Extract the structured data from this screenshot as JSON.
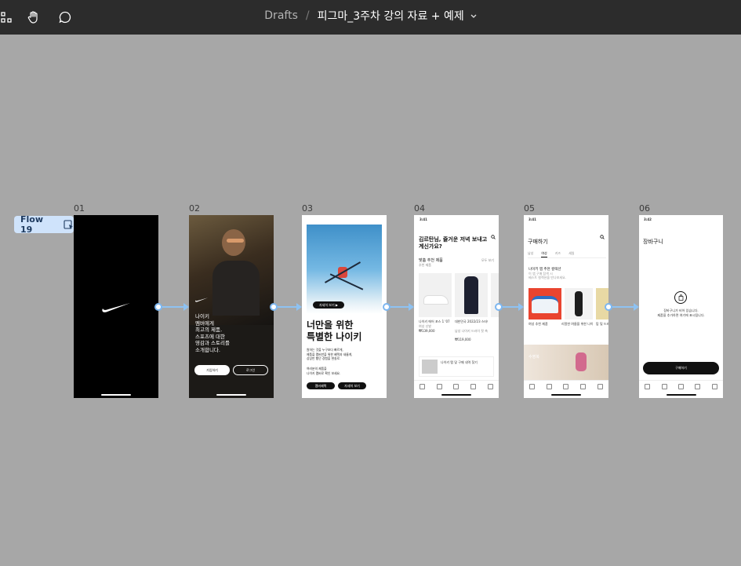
{
  "toolbar": {
    "breadcrumb_drafts": "Drafts",
    "breadcrumb_separator": "/",
    "file_name": "피그마_3주차 강의 자료 + 예제",
    "icons": [
      "select-tool-icon",
      "hand-tool-icon",
      "comment-icon",
      "chevron-down-icon"
    ]
  },
  "flow": {
    "label": "Flow 19"
  },
  "frames": [
    {
      "label": "01"
    },
    {
      "label": "02",
      "text": "나이키\n멤버에게\n최고의 제품,\n스포츠에 대한\n영감과 스토리를\n소개합니다.",
      "btn_join": "가입하기",
      "btn_login": "로그인"
    },
    {
      "label": "03",
      "headline": "너만을 위한\n특별한 나이키",
      "img_button": "자세히 보기 ▶",
      "body": "원하는 것을 누구보다 빠르게,\n제품을 멤버만을 위한 혜택과 새롭게,\n상상만 했던 경험을 현실로.",
      "body2": "여러분의 제품을\n나이키 멤버로 확인 보세요.",
      "btn_a": "멤버혜택",
      "btn_b": "자세히 보기"
    },
    {
      "label": "04",
      "time": "3:41",
      "greeting": "김르탄님, 즐거운 저녁 보내고 계신가요?",
      "section": "맞춤 추천 제품",
      "section_sub": "추천 제품",
      "more": "모두 보기",
      "p1_name": "나이키 에어 포스 1 '07",
      "p1_cat": "여성 신발",
      "p1_price": "₩139,000",
      "p2_name": "대한민국 2022/23 스타디움 어웨이",
      "p2_cat": "남성 나이키 드라이 핏 축구",
      "p2_price": "₩119,000",
      "banner": "나이키 멤 및 구매 내역 찾기"
    },
    {
      "label": "05",
      "time": "3:41",
      "title": "구매하기",
      "tabs": [
        "남성",
        "여성",
        "키즈",
        "세일"
      ],
      "section": "나이키 앱 추천 컬렉션",
      "section_sub": "이 앱 구매 탐색 시\n베스트 컬렉션을 만나보세요.",
      "c1": "여성 추천 제품",
      "c2": "리얼한 여름을 위한 나이키 스포츠 웨어",
      "c3": "탑 및 드레스",
      "banner": "수영복"
    },
    {
      "label": "06",
      "time": "3:42",
      "title": "장바구니",
      "empty1": "장바구니가 비어 있습니다.",
      "empty2": "제품을 추가하면 여기에 표시됩니다.",
      "checkout": "구매하기"
    }
  ],
  "tab_icons": [
    "home-icon",
    "search-icon",
    "heart-icon",
    "bag-icon",
    "profile-icon"
  ],
  "colors": {
    "toolbar_bg": "#2c2c2c",
    "canvas_bg": "#a7a7a7",
    "flow_blue": "#8ec2f2",
    "flow_tag_bg": "#cfe3fb"
  }
}
